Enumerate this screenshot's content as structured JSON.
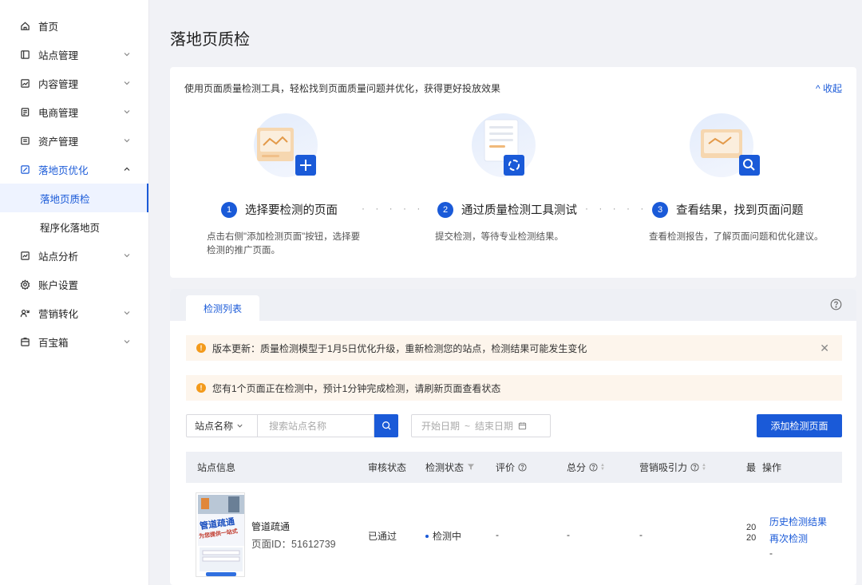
{
  "sidebar": {
    "items": [
      {
        "label": "首页",
        "icon": "home-icon",
        "chevron": false
      },
      {
        "label": "站点管理",
        "icon": "site-icon",
        "chevron": true
      },
      {
        "label": "内容管理",
        "icon": "content-icon",
        "chevron": true
      },
      {
        "label": "电商管理",
        "icon": "ecommerce-icon",
        "chevron": true
      },
      {
        "label": "资产管理",
        "icon": "asset-icon",
        "chevron": true
      },
      {
        "label": "落地页优化",
        "icon": "landing-page-icon",
        "chevron": true,
        "expanded": true
      },
      {
        "label": "站点分析",
        "icon": "analytics-icon",
        "chevron": true
      },
      {
        "label": "账户设置",
        "icon": "settings-icon",
        "chevron": false
      },
      {
        "label": "营销转化",
        "icon": "marketing-icon",
        "chevron": true
      },
      {
        "label": "百宝箱",
        "icon": "toolbox-icon",
        "chevron": true
      }
    ],
    "sub_items": [
      {
        "label": "落地页质检",
        "active": true
      },
      {
        "label": "程序化落地页",
        "active": false
      }
    ]
  },
  "page": {
    "title": "落地页质检"
  },
  "intro": {
    "description": "使用页面质量检测工具，轻松找到页面质量问题并优化，获得更好投放效果",
    "collapse_label": "^ 收起",
    "steps": [
      {
        "num": "1",
        "title": "选择要检测的页面",
        "desc": "点击右侧\"添加检测页面\"按钮，选择要检测的推广页面。"
      },
      {
        "num": "2",
        "title": "通过质量检测工具测试",
        "desc": "提交检测，等待专业检测结果。"
      },
      {
        "num": "3",
        "title": "查看结果，找到页面问题",
        "desc": "查看检测报告，了解页面问题和优化建议。"
      }
    ],
    "dots": "· · · · ·"
  },
  "list": {
    "tab_label": "检测列表",
    "alerts": [
      {
        "text": "版本更新：质量检测模型于1月5日优化升级，重新检测您的站点，检测结果可能发生变化",
        "closable": true
      },
      {
        "text": "您有1个页面正在检测中，预计1分钟完成检测，请刷新页面查看状态",
        "closable": false
      }
    ],
    "filter": {
      "select_label": "站点名称",
      "search_placeholder": "搜索站点名称",
      "date_start": "开始日期",
      "date_sep": "~",
      "date_end": "结束日期",
      "add_button": "添加检测页面"
    },
    "columns": [
      "站点信息",
      "审核状态",
      "检测状态",
      "评价",
      "总分",
      "营销吸引力",
      "最",
      "操作"
    ],
    "rows": [
      {
        "thumb_title": "管道疏通",
        "thumb_subtitle": "为您提供一站式",
        "site_name": "管道疏通",
        "page_id": "页面ID：51612739",
        "review_status": "已通过",
        "check_status": "检测中",
        "rating": "-",
        "total": "-",
        "marketing": "-",
        "latest_1": "20",
        "latest_2": "20",
        "actions": [
          "历史检测结果",
          "再次检测",
          "-"
        ]
      }
    ]
  },
  "colors": {
    "accent": "#1a5ad8",
    "warning": "#f39a1b",
    "alert_bg": "#fdf5ec"
  }
}
